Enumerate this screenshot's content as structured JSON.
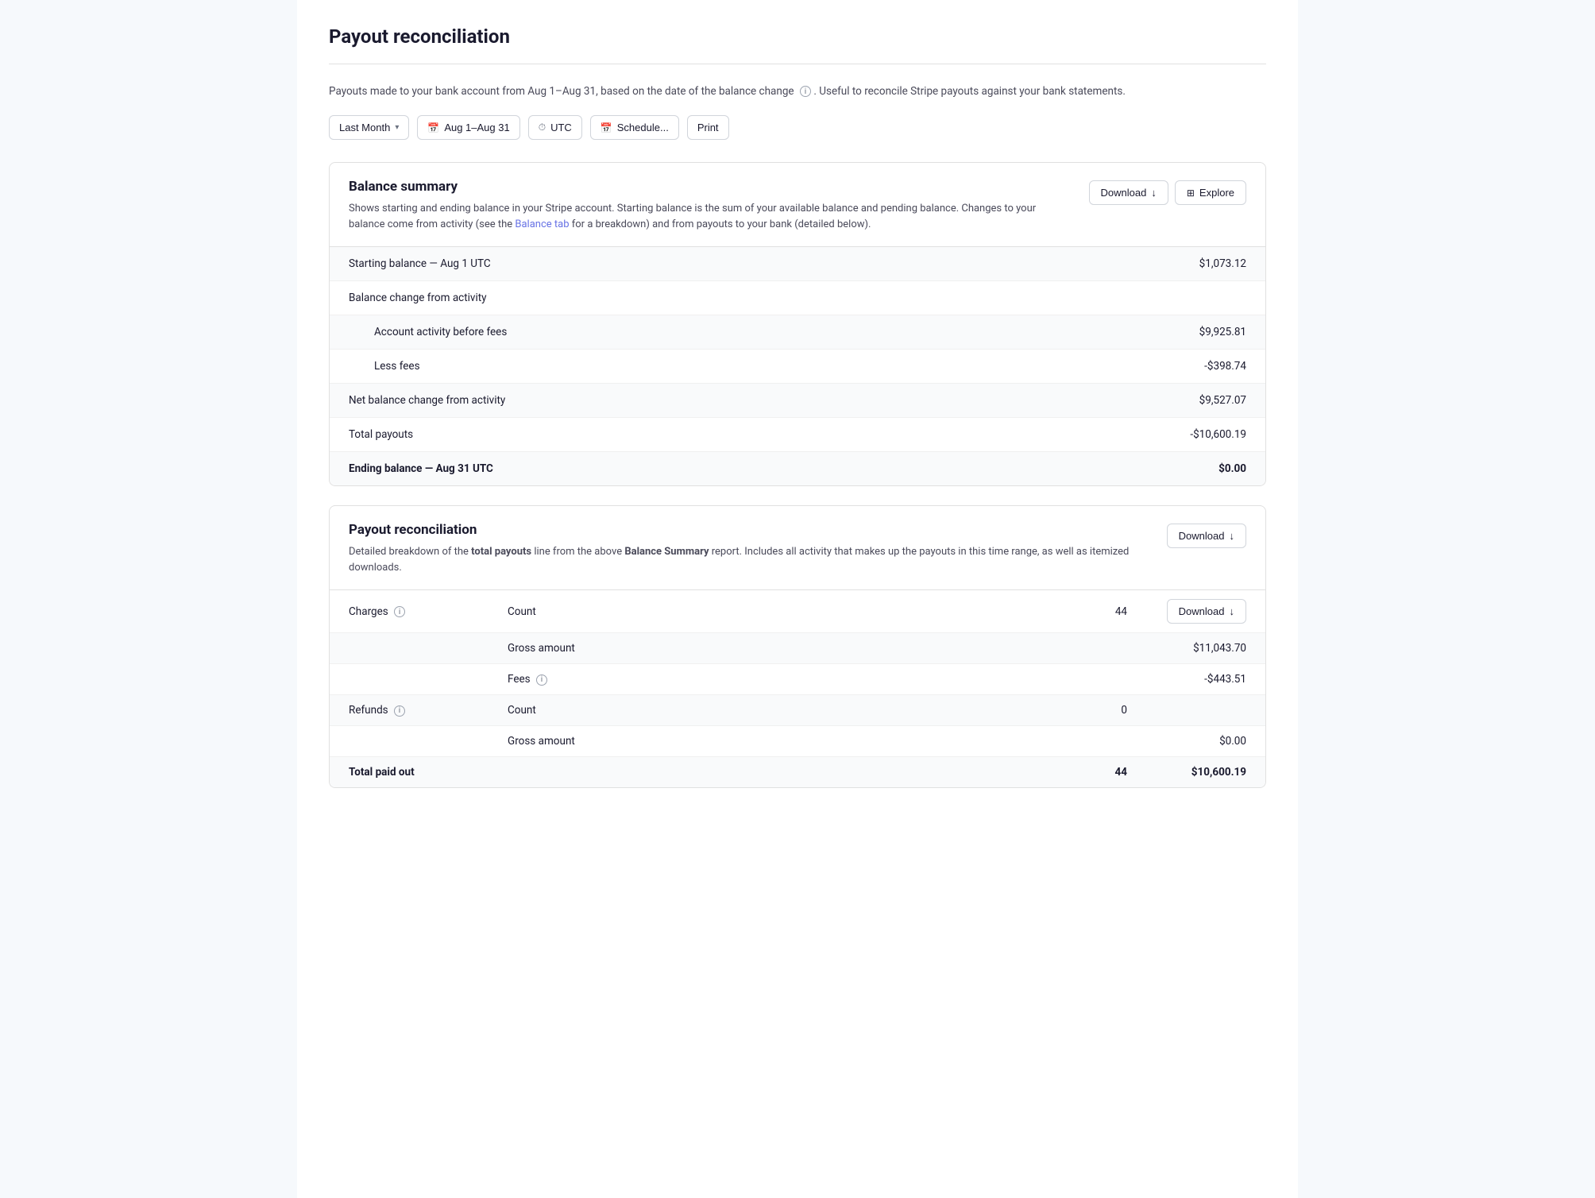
{
  "page": {
    "title": "Payout reconciliation"
  },
  "description": {
    "text": "Payouts made to your bank account from Aug 1–Aug 31, based on the date of the balance change",
    "suffix": ". Useful to reconcile Stripe payouts against your bank statements."
  },
  "filters": {
    "period_label": "Last Month",
    "date_range": "Aug 1–Aug 31",
    "timezone": "UTC",
    "schedule_label": "Schedule...",
    "print_label": "Print"
  },
  "balance_summary": {
    "title": "Balance summary",
    "description": "Shows starting and ending balance in your Stripe account. Starting balance is the sum of your available balance and pending balance. Changes to your balance come from activity (see the",
    "link_text": "Balance tab",
    "description_suffix": "for a breakdown) and from payouts to your bank (detailed below).",
    "download_label": "Download",
    "explore_label": "Explore",
    "rows": [
      {
        "label": "Starting balance — Aug 1 UTC",
        "value": "$1,073.12",
        "bold": true,
        "indented": false
      },
      {
        "label": "Balance change from activity",
        "value": "",
        "bold": false,
        "indented": false
      },
      {
        "label": "Account activity before fees",
        "value": "$9,925.81",
        "bold": false,
        "indented": true
      },
      {
        "label": "Less fees",
        "value": "-$398.74",
        "bold": false,
        "indented": true
      },
      {
        "label": "Net balance change from activity",
        "value": "$9,527.07",
        "bold": false,
        "indented": false
      },
      {
        "label": "Total payouts",
        "value": "-$10,600.19",
        "bold": false,
        "indented": false
      },
      {
        "label": "Ending balance — Aug 31 UTC",
        "value": "$0.00",
        "bold": true,
        "indented": false
      }
    ]
  },
  "payout_reconciliation": {
    "title": "Payout reconciliation",
    "description_prefix": "Detailed breakdown of the",
    "bold_text": "total payouts",
    "description_middle": "line from the above",
    "bold_text2": "Balance Summary",
    "description_suffix": "report. Includes all activity that makes up the payouts in this time range, as well as itemized downloads.",
    "download_label": "Download",
    "sections": [
      {
        "category": "Charges",
        "has_info": true,
        "download_label": "Download",
        "rows": [
          {
            "sub": "Count",
            "count": "44",
            "amount": ""
          },
          {
            "sub": "Gross amount",
            "count": "",
            "amount": "$11,043.70"
          },
          {
            "sub": "Fees",
            "count": "",
            "amount": "-$443.51",
            "has_info": true
          }
        ]
      },
      {
        "category": "Refunds",
        "has_info": true,
        "download_label": "",
        "rows": [
          {
            "sub": "Count",
            "count": "0",
            "amount": ""
          },
          {
            "sub": "Gross amount",
            "count": "",
            "amount": "$0.00"
          }
        ]
      }
    ],
    "total_row": {
      "label": "Total paid out",
      "count": "44",
      "amount": "$10,600.19"
    }
  },
  "icons": {
    "calendar": "📅",
    "clock": "🕐",
    "download_arrow": "↓",
    "info": "i",
    "grid": "⊞"
  }
}
